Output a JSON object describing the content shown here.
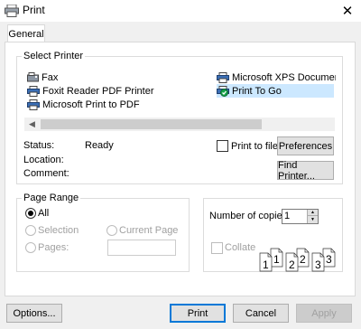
{
  "window": {
    "title": "Print",
    "icon": "printer-icon",
    "close_glyph": "✕"
  },
  "tabs": [
    {
      "label": "General",
      "active": true
    }
  ],
  "select_printer": {
    "legend": "Select Printer",
    "printers": [
      {
        "name": "Fax",
        "icon": "fax-icon",
        "selected": false
      },
      {
        "name": "Foxit Reader PDF Printer",
        "icon": "printer-icon",
        "selected": false
      },
      {
        "name": "Microsoft Print to PDF",
        "icon": "printer-icon",
        "selected": false
      },
      {
        "name": "Microsoft XPS Documen",
        "icon": "printer-icon",
        "selected": false
      },
      {
        "name": "Print To Go",
        "icon": "default-printer-icon",
        "selected": true
      }
    ],
    "scroll_left": "◀",
    "status_label": "Status:",
    "status_value": "Ready",
    "location_label": "Location:",
    "location_value": "",
    "comment_label": "Comment:",
    "comment_value": "",
    "print_to_file": {
      "label": "Print to file",
      "checked": false
    },
    "preferences_label": "Preferences",
    "find_printer_label": "Find Printer..."
  },
  "page_range": {
    "legend": "Page Range",
    "all_label": "All",
    "selection_label": "Selection",
    "current_page_label": "Current Page",
    "pages_label": "Pages:",
    "pages_value": "",
    "selected": "All"
  },
  "copies": {
    "number_label": "Number of copies:",
    "number_value": "1",
    "collate_label": "Collate",
    "collate_checked": false,
    "page_labels": [
      "1",
      "1",
      "2",
      "2",
      "3",
      "3"
    ]
  },
  "footer": {
    "options_label": "Options...",
    "print_label": "Print",
    "cancel_label": "Cancel",
    "apply_label": "Apply"
  },
  "colors": {
    "accent": "#0078d7",
    "selection": "#cce8ff",
    "default_check": "#16a34a"
  }
}
